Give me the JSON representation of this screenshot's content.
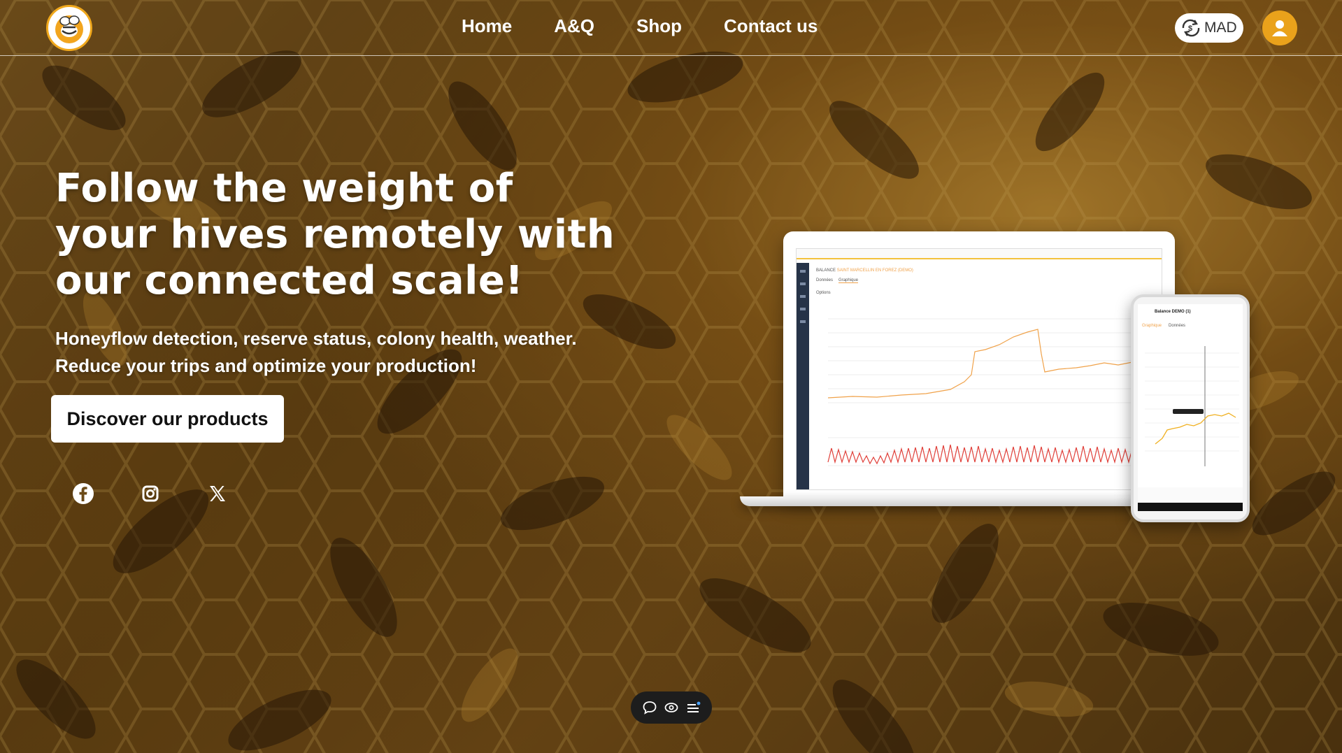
{
  "header": {
    "nav": [
      "Home",
      "A&Q",
      "Shop",
      "Contact us"
    ],
    "currency": "MAD"
  },
  "hero": {
    "headline_lines": [
      "Follow the weight of",
      "your hives remotely with",
      "our connected scale!"
    ],
    "subtext_lines": [
      "Honeyflow detection, reserve status, colony health, weather.",
      "Reduce your trips and optimize your production!"
    ],
    "cta_label": "Discover our products"
  },
  "devices": {
    "laptop_screen": {
      "breadcrumb_prefix": "BALANCE",
      "breadcrumb_title": "SAINT MARCELLIN EN FOREZ (DEMO)",
      "tabs": [
        "Données",
        "Graphique"
      ],
      "options_label": "Options"
    },
    "phone_screen": {
      "title": "Balance DEMO (1)",
      "tabs": [
        "Graphique",
        "Données"
      ]
    }
  },
  "socials": [
    "facebook-icon",
    "instagram-icon",
    "x-twitter-icon"
  ],
  "colors": {
    "accent": "#eaa21b",
    "cta_bg": "#ffffff",
    "chart_weight": "#f0a24a",
    "chart_temp": "#e0403a"
  }
}
